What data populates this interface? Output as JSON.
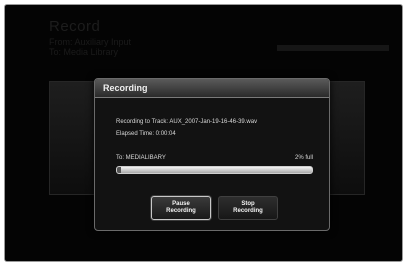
{
  "background": {
    "title": "Record",
    "from": "From: Auxiliary Input",
    "to": "To: Media Library"
  },
  "dialog": {
    "title": "Recording",
    "track_line": "Recording to Track: AUX_2007-Jan-19-16-46-39.wav",
    "elapsed_line": "Elapsed Time: 0:00:04",
    "destination": "To: MEDIALIBARY",
    "percent_full": "2% full",
    "progress_fraction": 0.02
  },
  "buttons": {
    "pause_line1": "Pause",
    "pause_line2": "Recording",
    "stop_line1": "Stop",
    "stop_line2": "Recording"
  },
  "colors": {
    "screen_bg": "#040404",
    "dialog_bg": "#121212",
    "text": "#d8d8d8"
  }
}
